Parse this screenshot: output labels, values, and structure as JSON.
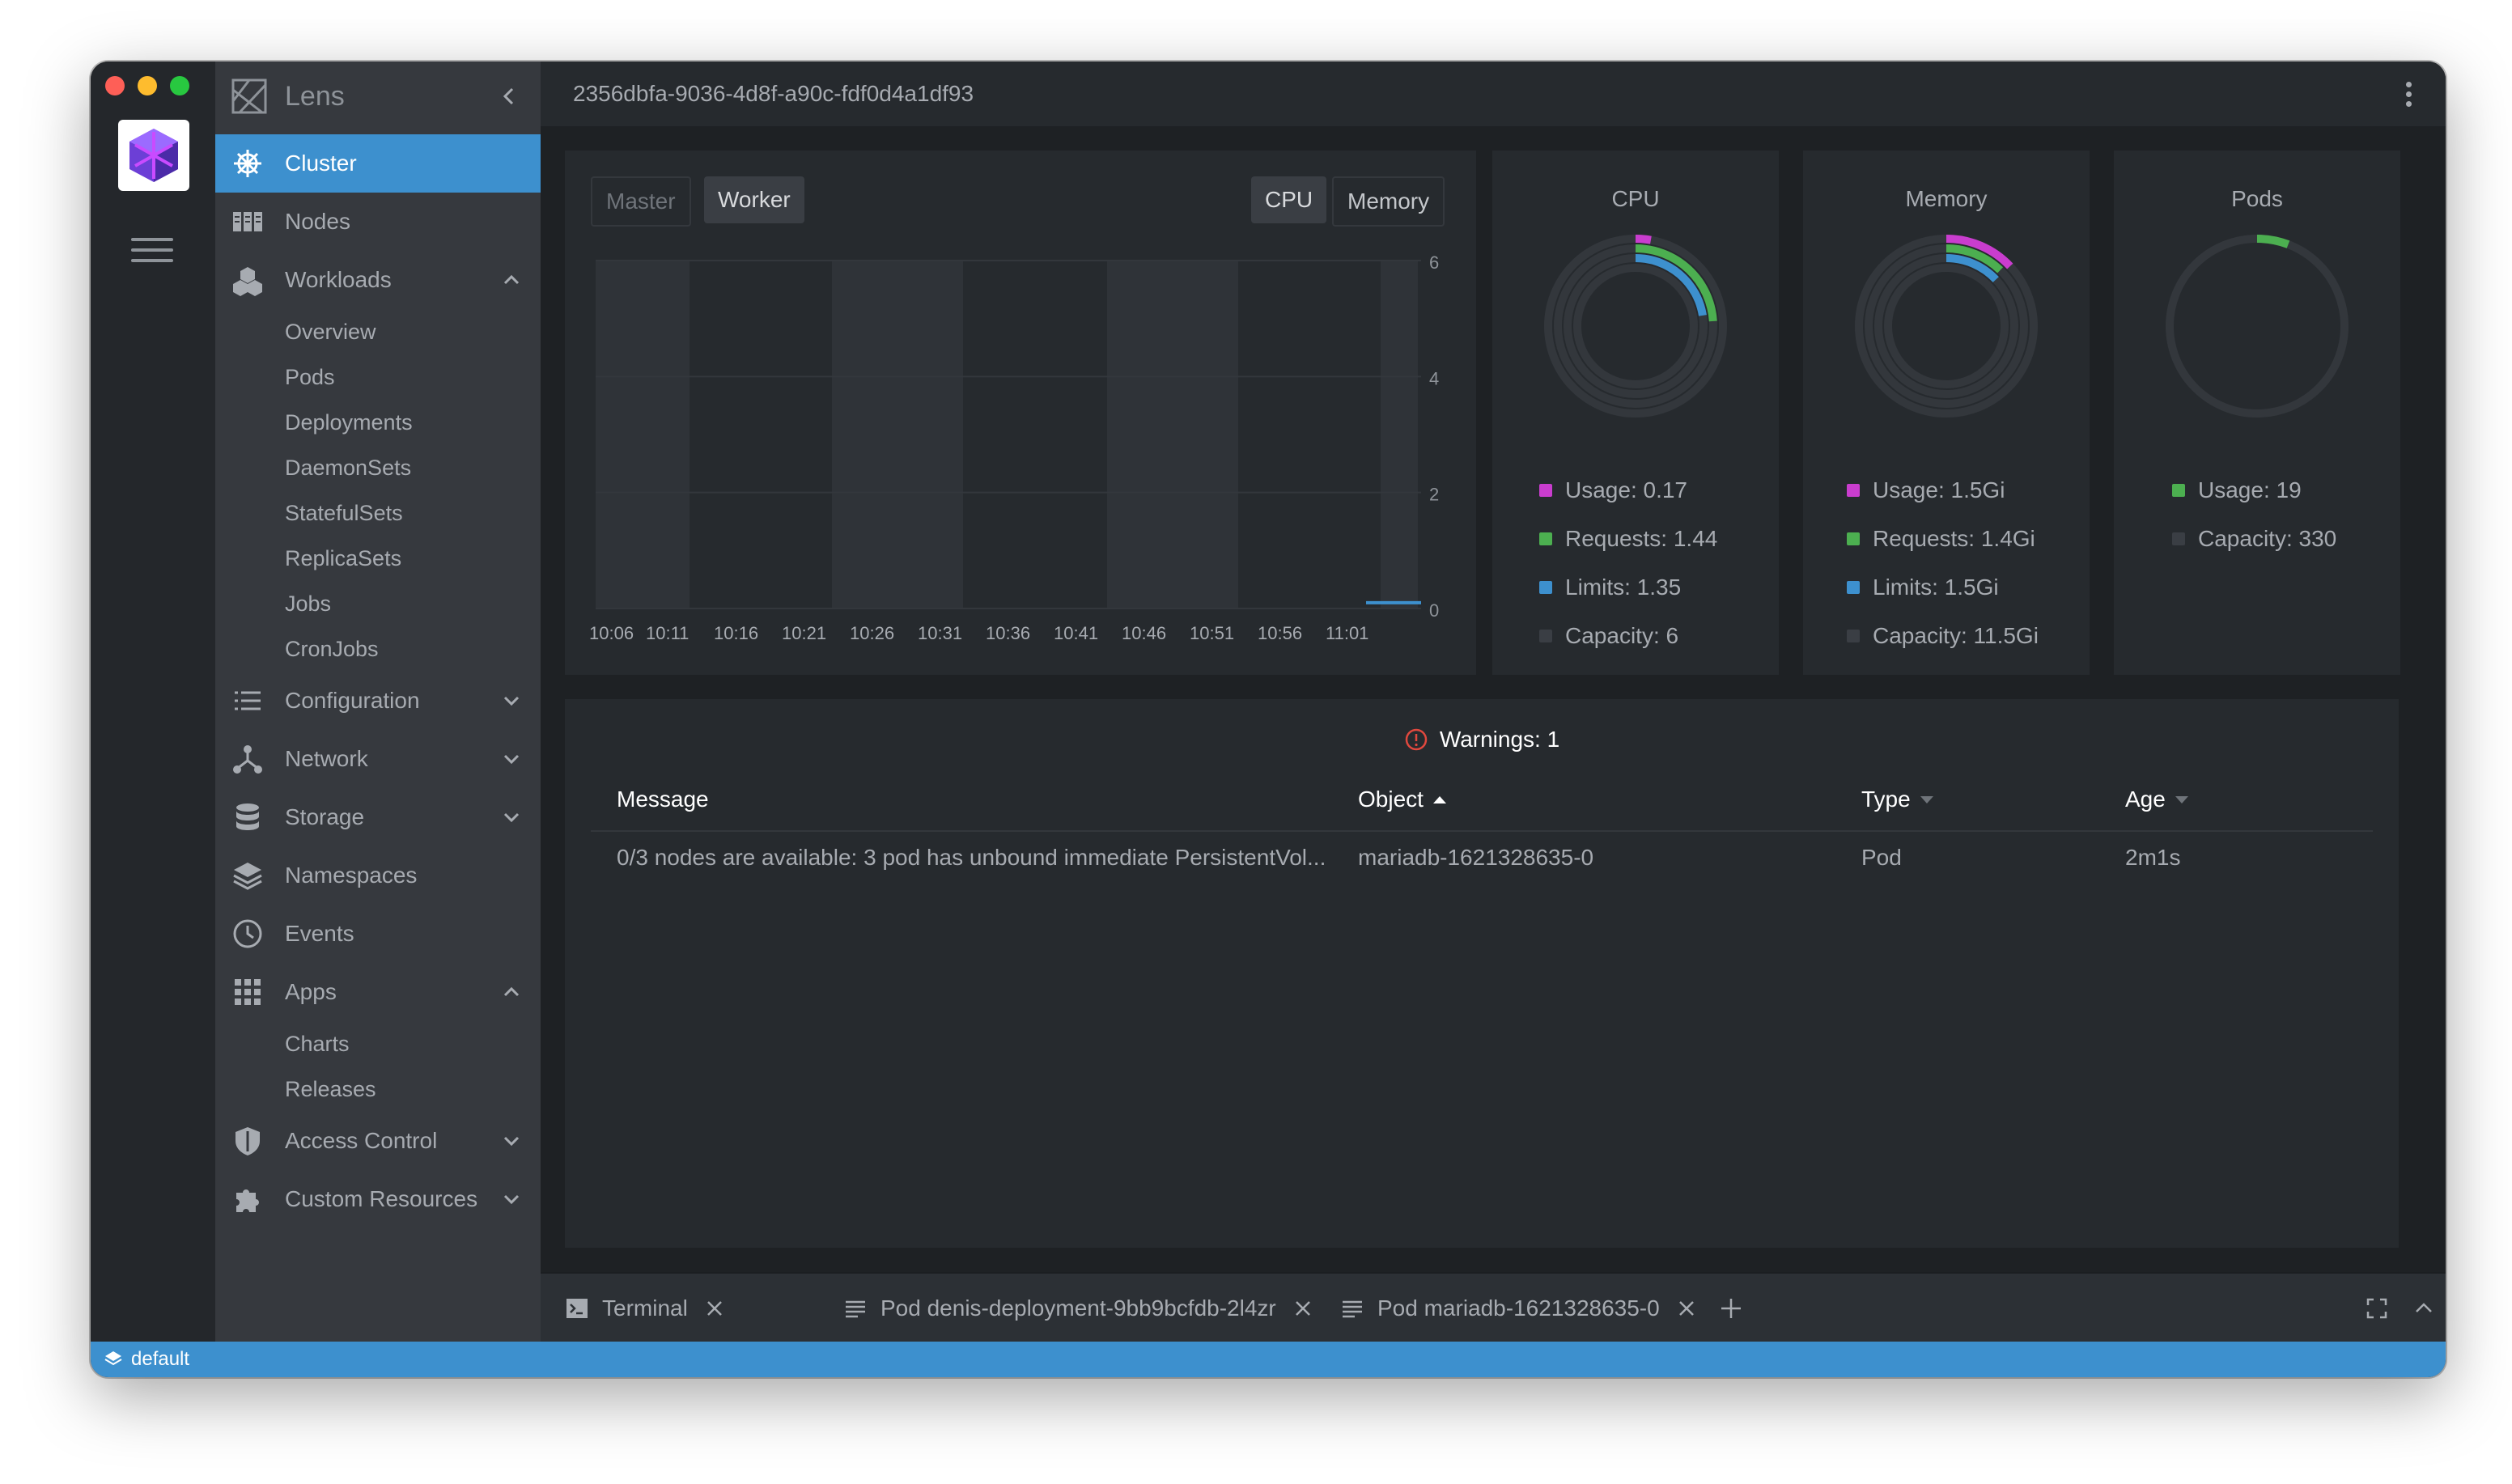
{
  "sidebar": {
    "title": "Lens",
    "items": [
      {
        "label": "Cluster",
        "icon": "helm-wheel-icon"
      },
      {
        "label": "Nodes",
        "icon": "nodes-icon"
      },
      {
        "label": "Workloads",
        "icon": "workloads-icon"
      },
      {
        "label": "Configuration",
        "icon": "list-icon"
      },
      {
        "label": "Network",
        "icon": "network-icon"
      },
      {
        "label": "Storage",
        "icon": "database-icon"
      },
      {
        "label": "Namespaces",
        "icon": "layers-icon"
      },
      {
        "label": "Events",
        "icon": "clock-icon"
      },
      {
        "label": "Apps",
        "icon": "apps-grid-icon"
      },
      {
        "label": "Access Control",
        "icon": "shield-icon"
      },
      {
        "label": "Custom Resources",
        "icon": "puzzle-icon"
      }
    ],
    "workloads_sub": [
      "Overview",
      "Pods",
      "Deployments",
      "DaemonSets",
      "StatefulSets",
      "ReplicaSets",
      "Jobs",
      "CronJobs"
    ],
    "apps_sub": [
      "Charts",
      "Releases"
    ]
  },
  "header": {
    "cluster_id": "2356dbfa-9036-4d8f-a90c-fdf0d4a1df93"
  },
  "chart_panel": {
    "node_tabs": [
      "Master",
      "Worker"
    ],
    "selected_node_tab": "Worker",
    "metric_tabs": [
      "CPU",
      "Memory"
    ],
    "selected_metric_tab": "CPU"
  },
  "chart_data": {
    "type": "bar",
    "categories": [
      "10:06",
      "10:11",
      "10:16",
      "10:21",
      "10:26",
      "10:31",
      "10:36",
      "10:41",
      "10:46",
      "10:51",
      "10:56",
      "11:01"
    ],
    "ylim": [
      0,
      6
    ],
    "yticks": [
      0,
      2,
      4,
      6
    ],
    "series": [
      {
        "values": [
          0,
          0,
          0,
          0,
          0,
          0,
          0,
          0,
          0,
          0,
          0,
          0.1
        ],
        "color": "#3d90ce"
      }
    ]
  },
  "donuts": [
    {
      "title": "CPU",
      "legend": [
        {
          "label": "Usage: 0.17",
          "color": "#c93dce"
        },
        {
          "label": "Requests: 1.44",
          "color": "#4caf50"
        },
        {
          "label": "Limits: 1.35",
          "color": "#3d90ce"
        },
        {
          "label": "Capacity: 6",
          "color": "#3a3e44"
        }
      ],
      "fractions": [
        0.028,
        0.24,
        0.225
      ]
    },
    {
      "title": "Memory",
      "legend": [
        {
          "label": "Usage: 1.5Gi",
          "color": "#c93dce"
        },
        {
          "label": "Requests: 1.4Gi",
          "color": "#4caf50"
        },
        {
          "label": "Limits: 1.5Gi",
          "color": "#3d90ce"
        },
        {
          "label": "Capacity: 11.5Gi",
          "color": "#3a3e44"
        }
      ],
      "fractions": [
        0.13,
        0.122,
        0.13
      ]
    },
    {
      "title": "Pods",
      "legend": [
        {
          "label": "Usage: 19",
          "color": "#4caf50"
        },
        {
          "label": "Capacity: 330",
          "color": "#3a3e44"
        }
      ],
      "fractions": [
        0.058
      ]
    }
  ],
  "events": {
    "warnings_label": "Warnings: 1",
    "columns": [
      "Message",
      "Object",
      "Type",
      "Age"
    ],
    "rows": [
      {
        "message": "0/3 nodes are available: 3 pod has unbound immediate PersistentVol...",
        "object": "mariadb-1621328635-0",
        "type": "Pod",
        "age": "2m1s"
      }
    ]
  },
  "dock": {
    "tabs": [
      {
        "label": "Terminal",
        "icon": "terminal-icon"
      },
      {
        "label": "Pod denis-deployment-9bb9bcfdb-2l4zr",
        "icon": "log-icon"
      },
      {
        "label": "Pod mariadb-1621328635-0",
        "icon": "log-icon"
      }
    ]
  },
  "statusbar": {
    "context": "default"
  }
}
